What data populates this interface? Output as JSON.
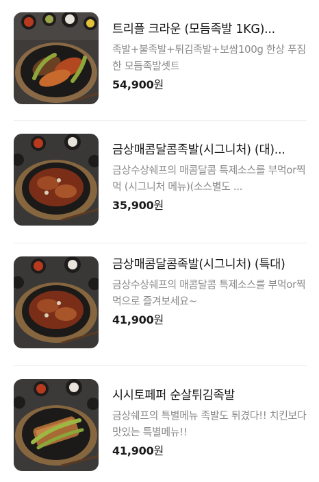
{
  "menu_items": [
    {
      "name": "트리플 크라운 (모듬족발 1KG)...",
      "description": "족발+불족발+튀김족발+보쌈100g 한상 푸짐한 모듬족발셋트",
      "price": "54,900",
      "currency": "원",
      "image_icon": "jokbal-platter-image"
    },
    {
      "name": "금상매콤달콤족발(시그니처) (대)...",
      "description": "금상수상쉐프의 매콤달콤 특제소스를 부먹or찍먹 (시그니처 메뉴)(소스별도 ...",
      "price": "35,900",
      "currency": "원",
      "image_icon": "spicy-jokbal-image"
    },
    {
      "name": "금상매콤달콤족발(시그니처) (특대)",
      "description": "금상수상쉐프의 매콤달콤 특제소스를 부먹or찍먹으로 즐겨보세요~",
      "price": "41,900",
      "currency": "원",
      "image_icon": "spicy-jokbal-image"
    },
    {
      "name": "시시토페퍼 순살튀김족발",
      "description": "금상쉐프의 특별메뉴 족발도 튀겼다!! 치킨보다 맛있는 특별메뉴!!",
      "price": "41,900",
      "currency": "원",
      "image_icon": "fried-jokbal-image"
    }
  ]
}
